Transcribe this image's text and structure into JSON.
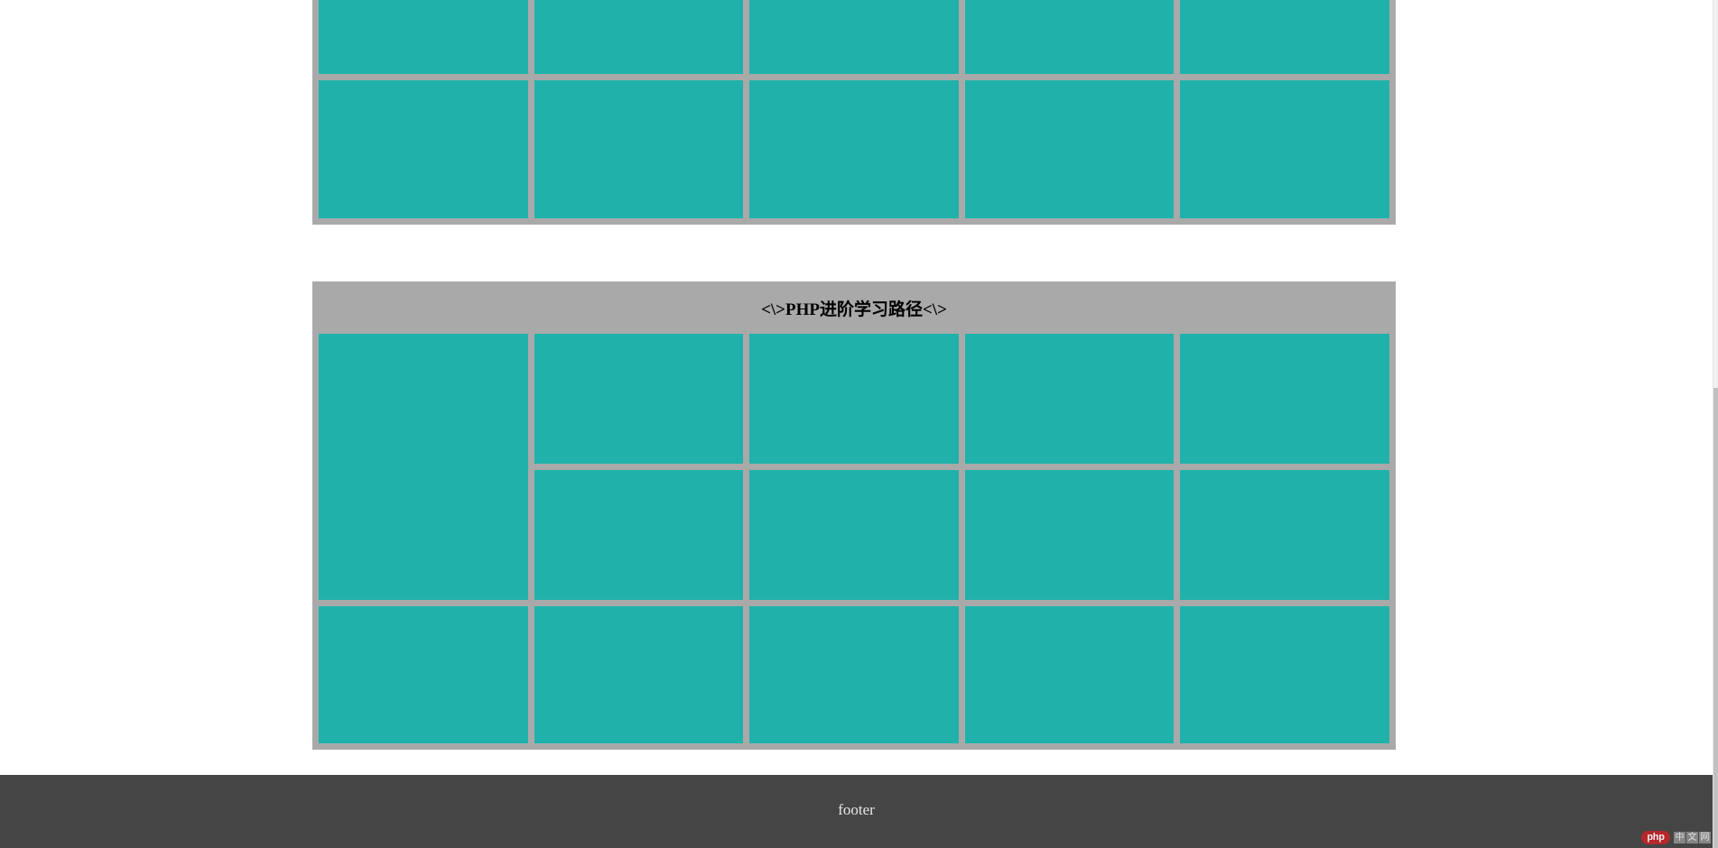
{
  "colors": {
    "cell_teal": "#20b2aa",
    "grid_gray": "#a9a9a9",
    "footer_bg": "#454545",
    "footer_text": "#e8e8e8",
    "header_text": "#000000",
    "page_bg": "#ffffff",
    "scrollbar_thumb": "#c1c1c1",
    "watermark_red": "#c0252a"
  },
  "table_one": {
    "name": "upper-grid-table",
    "columns": 5,
    "visible_rows": 2,
    "caption": "",
    "rows": [
      {
        "cells": [
          "",
          "",
          "",
          "",
          ""
        ]
      },
      {
        "cells": [
          "",
          "",
          "",
          "",
          ""
        ]
      }
    ]
  },
  "table_two": {
    "name": "php-learning-path-table",
    "header": "<\\>PHP进阶学习路径<\\>",
    "columns": 5,
    "rows": [
      {
        "cells": [
          "",
          "",
          "",
          "",
          ""
        ]
      },
      {
        "cells": [
          "",
          "",
          "",
          ""
        ]
      },
      {
        "cells": [
          "",
          "",
          "",
          "",
          ""
        ]
      }
    ]
  },
  "footer": {
    "text": "footer"
  },
  "watermark": {
    "brand": "php",
    "chars": [
      "中",
      "文",
      "网"
    ]
  },
  "scrollbar": {
    "orientation": "vertical",
    "thumb_label": "page-scroll-thumb"
  }
}
